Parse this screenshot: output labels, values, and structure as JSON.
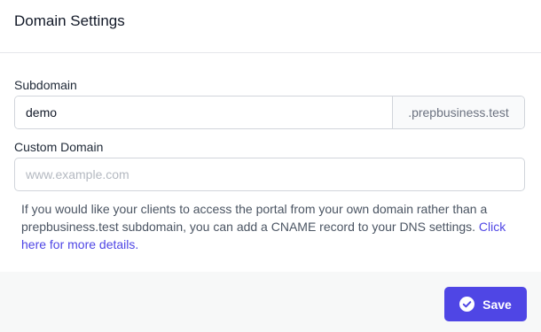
{
  "header": {
    "title": "Domain Settings"
  },
  "subdomain": {
    "label": "Subdomain",
    "value": "demo",
    "suffix": ".prepbusiness.test"
  },
  "custom_domain": {
    "label": "Custom Domain",
    "value": "",
    "placeholder": "www.example.com"
  },
  "help": {
    "text": "If you would like your clients to access the portal from your own domain rather than a prepbusiness.test subdomain, you can add a CNAME record to your DNS settings.",
    "link_text": "Click here for more details."
  },
  "footer": {
    "save_label": "Save",
    "save_icon": "check-circle-icon"
  },
  "colors": {
    "accent": "#4f46e5",
    "footer_bg": "#f7f8f8",
    "border": "#d1d5db"
  }
}
